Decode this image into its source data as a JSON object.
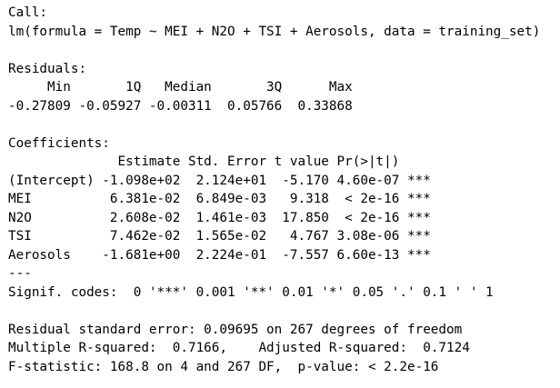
{
  "console": {
    "call_label": "Call:",
    "call_formula": "lm(formula = Temp ~ MEI + N2O + TSI + Aerosols, data = training_set)",
    "residuals_label": "Residuals:",
    "residuals_header": "     Min       1Q   Median       3Q      Max ",
    "residuals_values": "-0.27809 -0.05927 -0.00311  0.05766  0.33868 ",
    "coefficients_label": "Coefficients:",
    "coefficients_header": "              Estimate Std. Error t value Pr(>|t|)    ",
    "coefficients_rows": [
      "(Intercept) -1.098e+02  2.124e+01  -5.170 4.60e-07 ***",
      "MEI          6.381e-02  6.849e-03   9.318  < 2e-16 ***",
      "N2O          2.608e-02  1.461e-03  17.850  < 2e-16 ***",
      "TSI          7.462e-02  1.565e-02   4.767 3.08e-06 ***",
      "Aerosols    -1.681e+00  2.224e-01  -7.557 6.60e-13 ***"
    ],
    "separator": "---",
    "signif_codes": "Signif. codes:  0 '***' 0.001 '**' 0.01 '*' 0.05 '.' 0.1 ' ' 1",
    "residual_se": "Residual standard error: 0.09695 on 267 degrees of freedom",
    "r_squared": "Multiple R-squared:  0.7166,\tAdjusted R-squared:  0.7124 ",
    "f_statistic": "F-statistic: 168.8 on 4 and 267 DF,  p-value: < 2.2e-16"
  }
}
